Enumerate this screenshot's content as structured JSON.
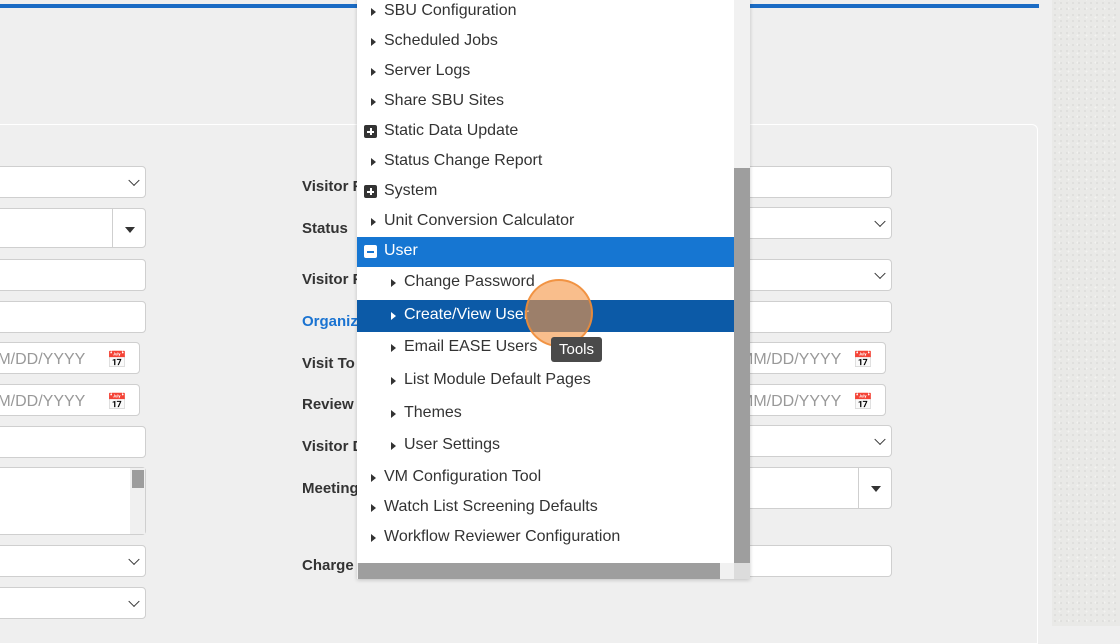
{
  "colors": {
    "accent": "#1a6bc4",
    "selected": "#1676d2",
    "active": "#0c5aa7",
    "link": "#1a73d1"
  },
  "form": {
    "labels": {
      "visitor_p": "Visitor F",
      "status": "Status",
      "visitor_p2": "Visitor F",
      "organization": "Organiz",
      "visit_to": "Visit To",
      "review": "Review",
      "visitor_d": "Visitor D",
      "meeting": "Meeting",
      "charge": "Charge"
    },
    "date_placeholder_left_1": "MM/DD/YYYY",
    "date_placeholder_left_2": "MM/DD/YYYY",
    "date_placeholder_right_1": "MM/DD/YYYY",
    "date_placeholder_right_2": "MM/DD/YYYY",
    "calendar_icon": "calendar-icon"
  },
  "menu": {
    "items": [
      {
        "label": "SBU Configuration",
        "icon": "triangle-right"
      },
      {
        "label": "Scheduled Jobs",
        "icon": "triangle-right"
      },
      {
        "label": "Server Logs",
        "icon": "triangle-right"
      },
      {
        "label": "Share SBU Sites",
        "icon": "triangle-right"
      },
      {
        "label": "Static Data Update",
        "icon": "plus-square"
      },
      {
        "label": "Status Change Report",
        "icon": "triangle-right"
      },
      {
        "label": "System",
        "icon": "plus-square"
      },
      {
        "label": "Unit Conversion Calculator",
        "icon": "triangle-right"
      },
      {
        "label": "User",
        "icon": "minus-square"
      }
    ],
    "sub_items": [
      {
        "label": "Change Password"
      },
      {
        "label": "Create/View User"
      },
      {
        "label": "Email EASE Users"
      },
      {
        "label": "List Module Default Pages"
      },
      {
        "label": "Themes"
      },
      {
        "label": "User Settings"
      }
    ],
    "tail_items": [
      {
        "label": "VM Configuration Tool"
      },
      {
        "label": "Watch List Screening Defaults"
      },
      {
        "label": "Workflow Reviewer Configuration"
      }
    ]
  },
  "tooltip": "Tools"
}
